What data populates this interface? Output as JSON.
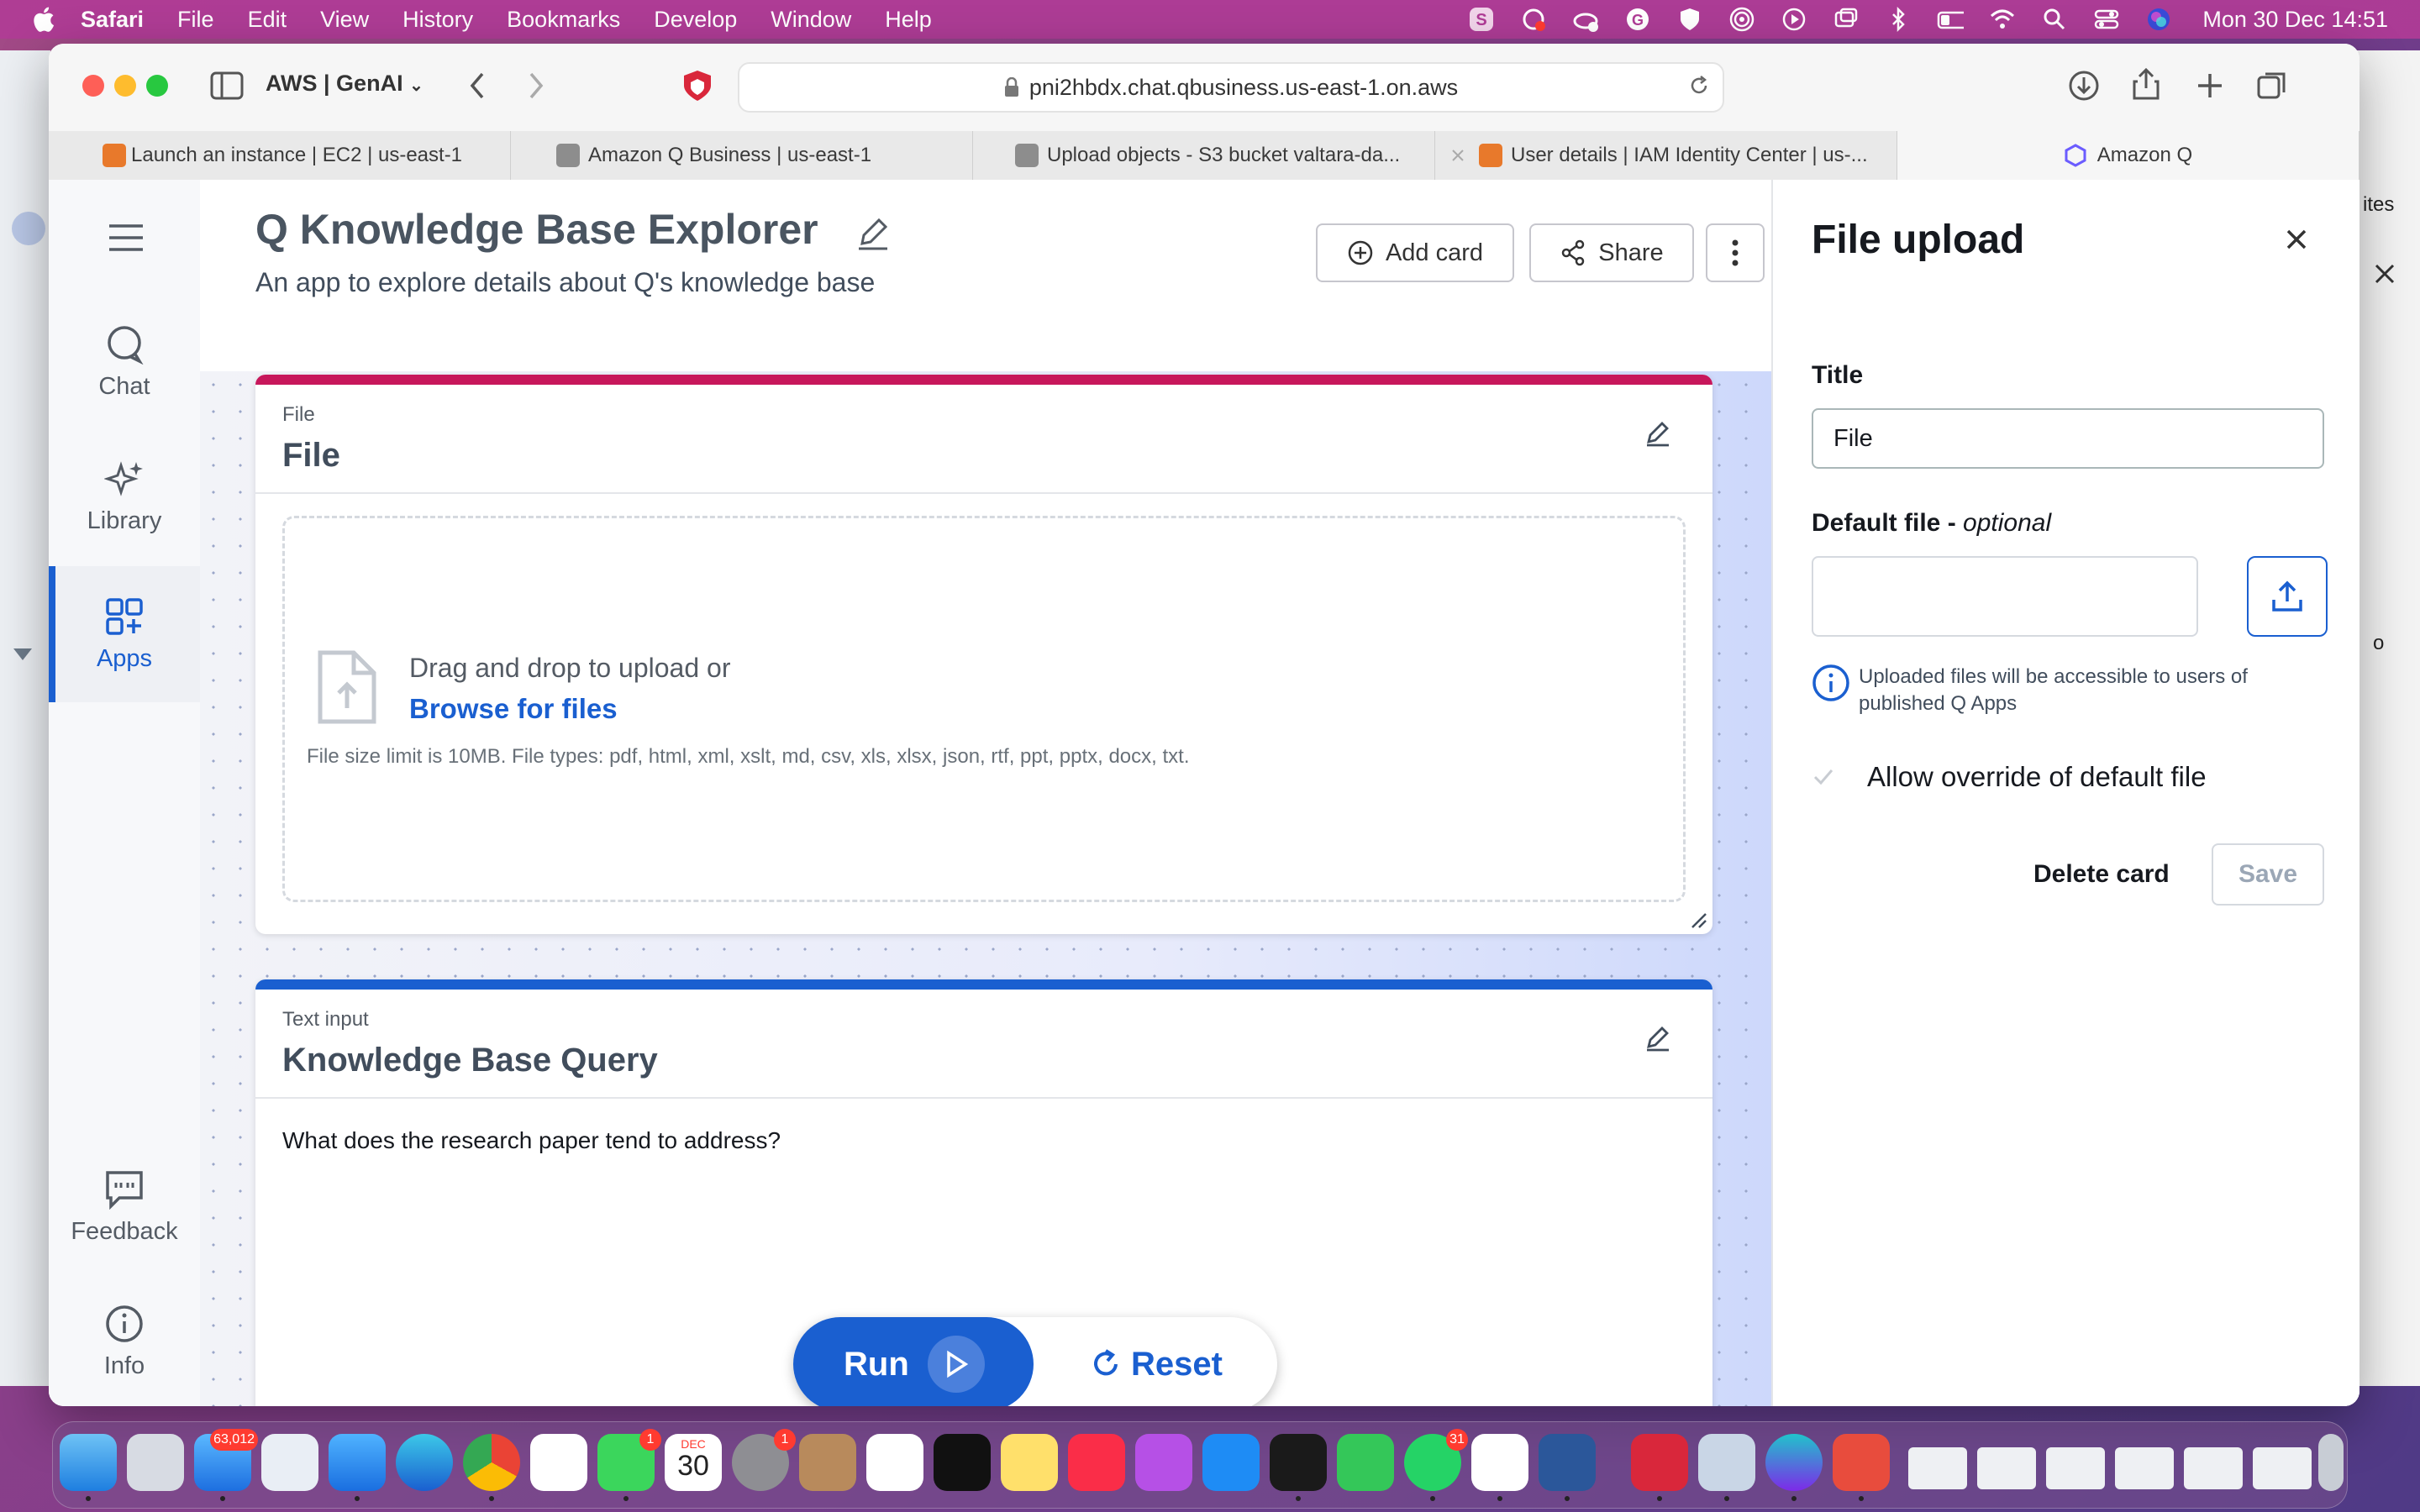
{
  "menubar": {
    "app_name": "Safari",
    "items": [
      "File",
      "Edit",
      "View",
      "History",
      "Bookmarks",
      "Develop",
      "Window",
      "Help"
    ],
    "clock": "Mon 30 Dec  14:51"
  },
  "browser": {
    "profile": "AWS | GenAI",
    "url": "pni2hbdx.chat.qbusiness.us-east-1.on.aws",
    "tabs": [
      {
        "label": "Launch an instance | EC2 | us-east-1",
        "color": "#e8792b"
      },
      {
        "label": "Amazon Q Business | us-east-1",
        "color": "#8d8d8d"
      },
      {
        "label": "Upload objects - S3 bucket valtara-da...",
        "color": "#8d8d8d"
      },
      {
        "label": "User details | IAM Identity Center | us-...",
        "color": "#e8792b"
      },
      {
        "label": "Amazon Q",
        "color": "#6b5cff"
      }
    ]
  },
  "background_window": {
    "text_1": "ites",
    "text_2": "o"
  },
  "nav": {
    "items": [
      {
        "label": "Chat",
        "icon": "chat-icon"
      },
      {
        "label": "Library",
        "icon": "sparkle-icon"
      },
      {
        "label": "Apps",
        "icon": "apps-grid-icon"
      },
      {
        "label": "Feedback",
        "icon": "feedback-icon"
      },
      {
        "label": "Info",
        "icon": "info-icon"
      }
    ]
  },
  "app": {
    "title": "Q Knowledge Base Explorer",
    "subtitle": "An app to explore details about Q's knowledge base",
    "add_card": "Add card",
    "share": "Share"
  },
  "cards": {
    "file": {
      "type": "File",
      "title": "File",
      "drop_text": "Drag and drop to upload or",
      "browse_text": "Browse for files",
      "limit_text": "File size limit is 10MB. File types: pdf, html, xml, xslt, md, csv, xls, xlsx, json, rtf, ppt, pptx, docx, txt."
    },
    "text_input": {
      "type": "Text input",
      "title": "Knowledge Base Query",
      "value": "What does the research paper tend to address?"
    }
  },
  "actions": {
    "run": "Run",
    "reset": "Reset"
  },
  "panel": {
    "title": "File upload",
    "title_label": "Title",
    "title_value": "File",
    "default_file_label": "Default file - ",
    "default_file_optional": "optional",
    "info_text": "Uploaded files will be accessible to users of published Q Apps",
    "override_label": "Allow override of default file",
    "delete": "Delete card",
    "save": "Save"
  },
  "dock": {
    "badges": {
      "mail": "63,012",
      "messages": "1",
      "settings": "1",
      "whatsapp": "31"
    },
    "calendar_month": "DEC",
    "calendar_day": "30"
  },
  "colors": {
    "accent": "#1a5fd0",
    "file_card_bar": "#c7175b",
    "text_card_bar": "#1a5fd0"
  }
}
